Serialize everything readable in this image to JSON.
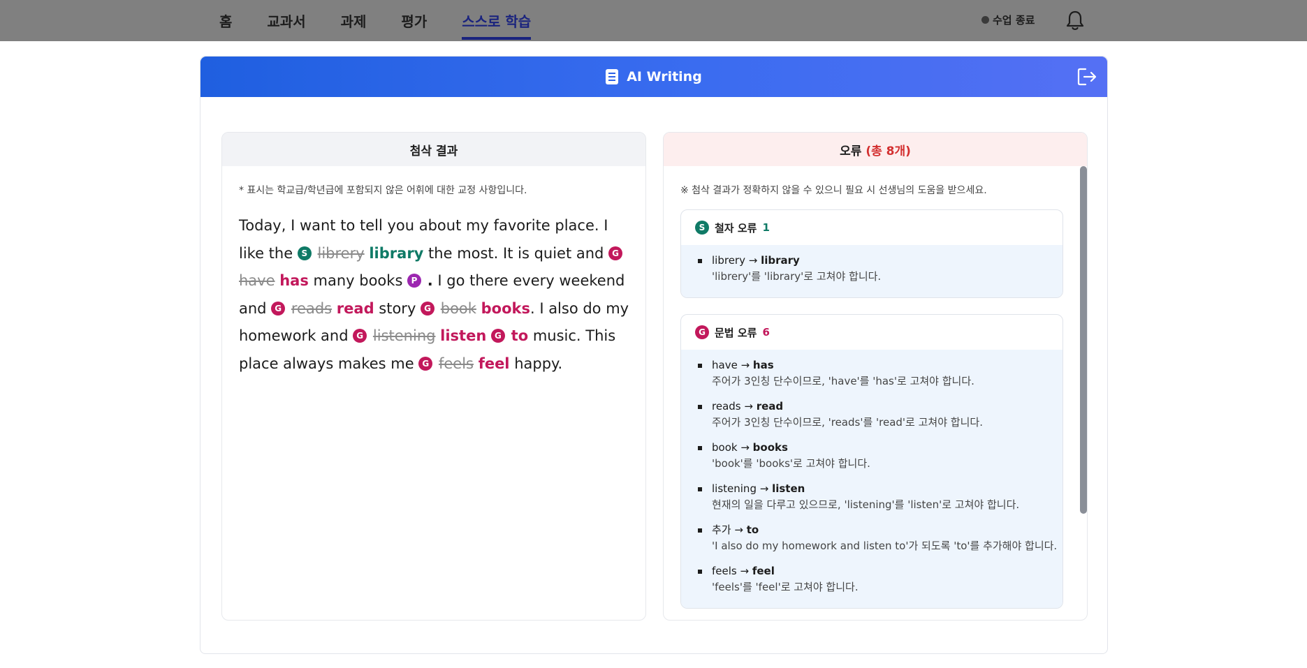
{
  "nav": {
    "items": [
      "홈",
      "교과서",
      "과제",
      "평가",
      "스스로 학습"
    ],
    "active_index": 4,
    "end_class": "수업 종료"
  },
  "card": {
    "title": "AI Writing"
  },
  "left_panel": {
    "title": "첨삭 결과",
    "note": "* 표시는 학교급/학년급에 포함되지 않은 어휘에 대한 교정 사항입니다.",
    "essay": {
      "t1": "Today, I want to tell you about my favorite place. I like the ",
      "s1_badge": "S",
      "s1_old": "librery",
      "s1_new": "library",
      "t2": " the most. It is quiet and ",
      "g1_badge": "G",
      "g1_old": "have",
      "g1_new": "has",
      "t3": " many books ",
      "p1_badge": "P",
      "p1_new": ".",
      "t4": " I go there every weekend and ",
      "g2_badge": "G",
      "g2_old": "reads",
      "g2_new": "read",
      "t5": " story ",
      "g3_badge": "G",
      "g3_old": "book",
      "g3_new": "books",
      "t6": ". I also do my homework and ",
      "g4_badge": "G",
      "g4_old": "listening",
      "g4_new": "listen",
      "g5_badge": "G",
      "g5_new": "to",
      "t7": " music. This place always makes me ",
      "g6_badge": "G",
      "g6_old": "feels",
      "g6_new": "feel",
      "t8": " happy."
    }
  },
  "right_panel": {
    "title": "오류",
    "count_label": "(총 8개)",
    "note": "※ 첨삭 결과가 정확하지 않을 수 있으니 필요 시 선생님의 도움을 받으세요.",
    "spelling": {
      "badge": "S",
      "label": "철자 오류",
      "count": "1",
      "items": [
        {
          "from": "librery",
          "to": "library",
          "desc": "'librery'를 'library'로 고쳐야 합니다."
        }
      ]
    },
    "grammar": {
      "badge": "G",
      "label": "문법 오류",
      "count": "6",
      "items": [
        {
          "from": "have",
          "to": "has",
          "desc": "주어가 3인칭 단수이므로, 'have'를 'has'로 고쳐야 합니다."
        },
        {
          "from": "reads",
          "to": "read",
          "desc": "주어가 3인칭 단수이므로, 'reads'를 'read'로 고쳐야 합니다."
        },
        {
          "from": "book",
          "to": "books",
          "desc": "'book'를 'books'로 고쳐야 합니다."
        },
        {
          "from": "listening",
          "to": "listen",
          "desc": "현재의 일을 다루고 있으므로, 'listening'를 'listen'로 고쳐야 합니다."
        },
        {
          "from": "추가",
          "to": "to",
          "desc": "'I also do my homework and listen to'가 되도록 'to'를 추가해야 합니다."
        },
        {
          "from": "feels",
          "to": "feel",
          "desc": "'feels'를 'feel'로 고쳐야 합니다."
        }
      ]
    }
  },
  "icons": {
    "bell": "bell-icon",
    "document": "document-icon",
    "exit": "exit-icon"
  },
  "colors": {
    "spelling": "#0f7a66",
    "grammar": "#c2185b",
    "punctuation": "#9c27b0",
    "error_count": "#d32f2f",
    "nav_active": "#1a237e"
  }
}
